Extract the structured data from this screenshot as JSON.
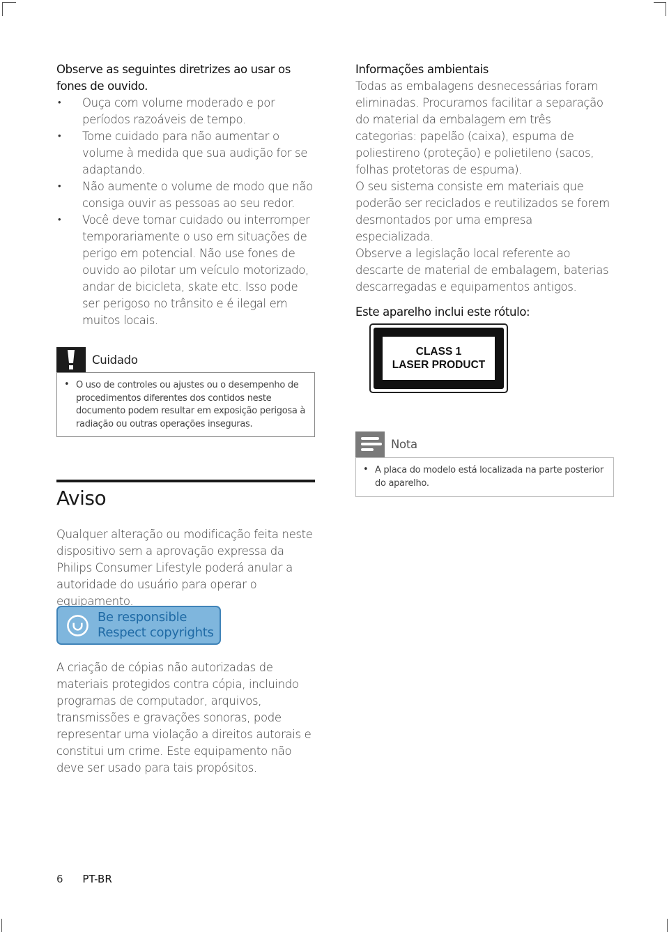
{
  "left": {
    "intro": "Observe as seguintes diretrizes ao usar os fones de ouvido.",
    "bullets": [
      "Ouça com volume moderado e por períodos razoáveis de tempo.",
      "Tome cuidado para não aumentar o volume à medida que sua audição for se adaptando.",
      "Não aumente o volume de modo que não consiga ouvir as pessoas ao seu redor.",
      "Você deve tomar cuidado ou interromper temporariamente o uso em situações de perigo em potencial. Não use fones de ouvido ao pilotar um veículo motorizado, andar de bicicleta, skate etc. Isso pode ser perigoso no trânsito e é ilegal em muitos locais."
    ],
    "caution": {
      "icon": "exclamation-icon",
      "title": "Cuidado",
      "items": [
        "O uso de controles ou ajustes ou o desempenho de procedimentos diferentes dos contidos neste documento podem resultar em exposição perigosa à radiação ou outras operações inseguras."
      ]
    },
    "aviso": {
      "title": "Aviso",
      "text": "Qualquer alteração ou modificação feita neste dispositivo sem a aprovação expressa da Philips Consumer Lifestyle poderá anular a autoridade do usuário para operar o equipamento."
    },
    "copyright_badge": {
      "icon": "smile-circle-icon",
      "line1": "Be responsible",
      "line2": "Respect copyrights",
      "bg_color": "#7fb6dd",
      "text_color": "#1f6aa5"
    },
    "copyright_text": "A criação de cópias não autorizadas de materiais protegidos contra cópia, incluindo programas de computador, arquivos, transmissões e gravações sonoras, pode representar uma violação a direitos autorais e constitui um crime. Este equipamento não deve ser usado para tais propósitos."
  },
  "right": {
    "env_title": "Informações ambientais",
    "env_paragraphs": [
      "Todas as embalagens desnecessárias foram eliminadas. Procuramos facilitar a separação do material da embalagem em três categorias: papelão (caixa), espuma de poliestireno (proteção) e polietileno (sacos, folhas protetoras de espuma).",
      "O seu sistema consiste em materiais que poderão ser reciclados e reutilizados se forem desmontados por uma empresa especializada.",
      "Observe a legislação local referente ao descarte de material de embalagem, baterias descarregadas e equipamentos antigos."
    ],
    "label_intro": "Este aparelho inclui este rótulo:",
    "laser_label": {
      "line1": "CLASS 1",
      "line2": "LASER PRODUCT"
    },
    "note": {
      "icon": "note-lines-icon",
      "title": "Nota",
      "items": [
        "A placa do modelo está localizada na parte posterior do aparelho."
      ]
    }
  },
  "footer": {
    "page_number": "6",
    "language": "PT-BR"
  }
}
